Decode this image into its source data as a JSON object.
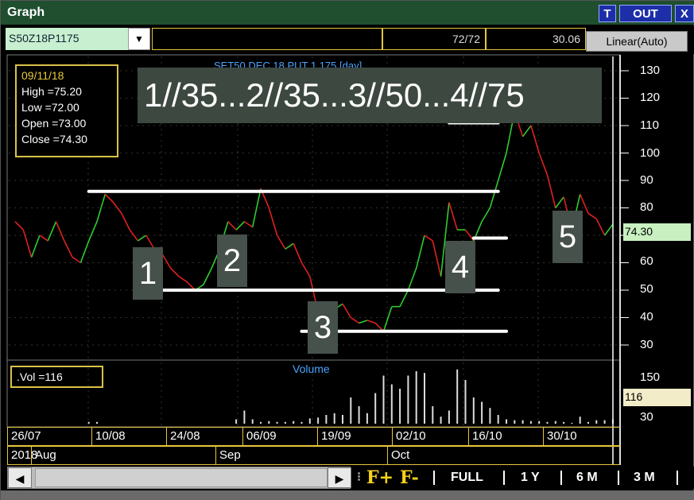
{
  "window": {
    "title": "Graph",
    "buttons": [
      "T",
      "OUT",
      "X"
    ]
  },
  "toolbar": {
    "symbol": "S50Z18P1175",
    "counter": "72/72",
    "last": "30.06",
    "scale": "Linear(Auto)"
  },
  "chart_title": "SET50 DEC 18 PUT 1,175 [day]",
  "info": {
    "date": "09/11/18",
    "high": "High  =75.20",
    "low": "Low   =72.00",
    "open": "Open  =73.00",
    "close": "Close  =74.30"
  },
  "banner": "1//35...2//35...3//50...4//75",
  "waves": [
    "1",
    "2",
    "3",
    "4",
    "5"
  ],
  "price_label": "74.30",
  "volume": {
    "box": ".Vol  =116",
    "title": "Volume",
    "label": "116"
  },
  "axis": {
    "price_ticks": [
      "130",
      "120",
      "110",
      "100",
      "90",
      "80",
      "70",
      "60",
      "50",
      "40",
      "30"
    ],
    "volume_ticks": [
      "150",
      "30"
    ]
  },
  "dates": [
    "26/07",
    "10/08",
    "24/08",
    "06/09",
    "19/09",
    "02/10",
    "16/10",
    "30/10"
  ],
  "months": [
    "2018",
    "Aug",
    "Sep",
    "Oct"
  ],
  "zoom": {
    "f_plus": "F+",
    "f_minus": "F-",
    "full": "FULL",
    "y1": "1 Y",
    "m6": "6 M",
    "m3": "3 M"
  },
  "colors": {
    "up": "#2ecc2e",
    "down": "#e02020",
    "accent": "#e7c63d",
    "title_blue": "#4aa3ff"
  },
  "chart_data": {
    "type": "line",
    "title": "SET50 DEC 18 PUT 1,175 [day]",
    "ylim": [
      25,
      135
    ],
    "prices": [
      75,
      72,
      62,
      70,
      68,
      75,
      68,
      62,
      60,
      68,
      75,
      85,
      82,
      78,
      72,
      68,
      70,
      65,
      63,
      58,
      55,
      53,
      50,
      52,
      58,
      65,
      75,
      72,
      75,
      73,
      87,
      80,
      70,
      65,
      67,
      60,
      55,
      42,
      40,
      43,
      45,
      40,
      38,
      39,
      38,
      35,
      44,
      44,
      50,
      58,
      70,
      68,
      55,
      82,
      72,
      72,
      68,
      75,
      80,
      90,
      100,
      115,
      106,
      110,
      100,
      92,
      80,
      84,
      72,
      85,
      78,
      76,
      70,
      74
    ],
    "volumes": [
      0,
      0,
      0,
      0,
      0,
      0,
      0,
      0,
      0,
      2,
      2,
      0,
      0,
      0,
      0,
      0,
      0,
      0,
      0,
      0,
      0,
      0,
      0,
      0,
      0,
      0,
      0,
      5,
      15,
      5,
      2,
      3,
      2,
      2,
      3,
      2,
      6,
      7,
      10,
      12,
      10,
      30,
      20,
      12,
      35,
      55,
      45,
      40,
      55,
      60,
      58,
      20,
      8,
      15,
      62,
      50,
      30,
      25,
      18,
      10,
      5,
      4,
      4,
      3,
      3,
      2,
      3,
      2,
      1,
      8,
      2,
      4,
      4,
      5
    ],
    "lines": [
      {
        "x": [
          9,
          59
        ],
        "y": [
          86,
          86
        ]
      },
      {
        "x": [
          18,
          59
        ],
        "y": [
          50,
          50
        ]
      },
      {
        "x": [
          35,
          60
        ],
        "y": [
          35,
          35
        ]
      },
      {
        "x": [
          53,
          59
        ],
        "y": [
          111,
          111
        ]
      },
      {
        "x": [
          56,
          60
        ],
        "y": [
          69,
          69
        ]
      }
    ]
  }
}
